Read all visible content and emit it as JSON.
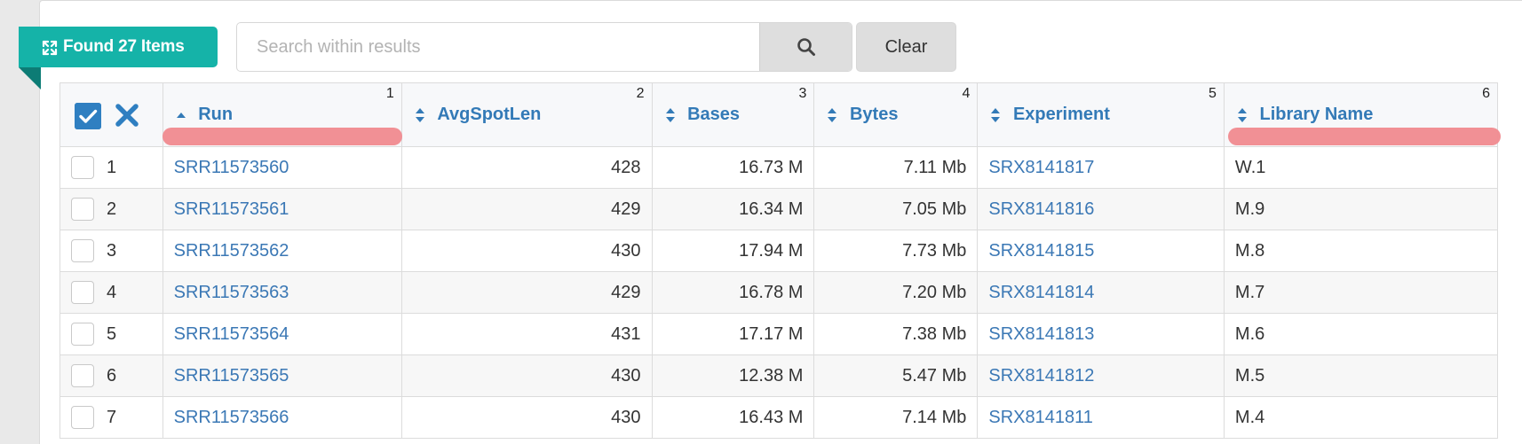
{
  "toolbar": {
    "found_label": "Found 27 Items",
    "search_placeholder": "Search within results",
    "search_value": "",
    "clear_label": "Clear"
  },
  "colors": {
    "badge": "#15b3a8",
    "link": "#3b78b5",
    "select_all": "#2f7fc1",
    "highlight": "#f08a8f"
  },
  "table": {
    "columns": [
      {
        "label": "Run",
        "num": "1",
        "sort": "asc"
      },
      {
        "label": "AvgSpotLen",
        "num": "2",
        "sort": "both"
      },
      {
        "label": "Bases",
        "num": "3",
        "sort": "both"
      },
      {
        "label": "Bytes",
        "num": "4",
        "sort": "both"
      },
      {
        "label": "Experiment",
        "num": "5",
        "sort": "both"
      },
      {
        "label": "Library Name",
        "num": "6",
        "sort": "both"
      }
    ],
    "rows": [
      {
        "idx": "1",
        "run": "SRR11573560",
        "avgspotlen": "428",
        "bases": "16.73 M",
        "bytes": "7.11 Mb",
        "experiment": "SRX8141817",
        "library": "W.1"
      },
      {
        "idx": "2",
        "run": "SRR11573561",
        "avgspotlen": "429",
        "bases": "16.34 M",
        "bytes": "7.05 Mb",
        "experiment": "SRX8141816",
        "library": "M.9"
      },
      {
        "idx": "3",
        "run": "SRR11573562",
        "avgspotlen": "430",
        "bases": "17.94 M",
        "bytes": "7.73 Mb",
        "experiment": "SRX8141815",
        "library": "M.8"
      },
      {
        "idx": "4",
        "run": "SRR11573563",
        "avgspotlen": "429",
        "bases": "16.78 M",
        "bytes": "7.20 Mb",
        "experiment": "SRX8141814",
        "library": "M.7"
      },
      {
        "idx": "5",
        "run": "SRR11573564",
        "avgspotlen": "431",
        "bases": "17.17 M",
        "bytes": "7.38 Mb",
        "experiment": "SRX8141813",
        "library": "M.6"
      },
      {
        "idx": "6",
        "run": "SRR11573565",
        "avgspotlen": "430",
        "bases": "12.38 M",
        "bytes": "5.47 Mb",
        "experiment": "SRX8141812",
        "library": "M.5"
      },
      {
        "idx": "7",
        "run": "SRR11573566",
        "avgspotlen": "430",
        "bases": "16.43 M",
        "bytes": "7.14 Mb",
        "experiment": "SRX8141811",
        "library": "M.4"
      }
    ]
  }
}
